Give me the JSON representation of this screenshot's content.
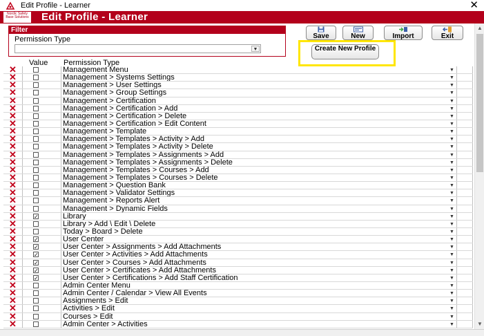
{
  "window": {
    "title": "Edit Profile - Learner",
    "close_glyph": "✕"
  },
  "header": {
    "title": "Edit Profile - Learner",
    "logo_text": "Nordic Safety Base Solutions"
  },
  "filter": {
    "heading": "Filter",
    "label": "Permission Type",
    "selected_value": ""
  },
  "toolbar": {
    "save_label": "Save",
    "new_label": "New",
    "import_label": "Import",
    "exit_label": "Exit",
    "create_new_profile_label": "Create New Profile"
  },
  "grid": {
    "columns": {
      "value": "Value",
      "permission_type": "Permission Type"
    },
    "rows": [
      {
        "checked": false,
        "text": "Management Menu"
      },
      {
        "checked": false,
        "text": "Management > Systems Settings"
      },
      {
        "checked": false,
        "text": "Management > User Settings"
      },
      {
        "checked": false,
        "text": "Management > Group Settings"
      },
      {
        "checked": false,
        "text": "Management > Certification"
      },
      {
        "checked": false,
        "text": "Management > Certification > Add"
      },
      {
        "checked": false,
        "text": "Management > Certification > Delete"
      },
      {
        "checked": false,
        "text": "Management > Certification > Edit Content"
      },
      {
        "checked": false,
        "text": "Management > Template"
      },
      {
        "checked": false,
        "text": "Management > Templates > Activity > Add"
      },
      {
        "checked": false,
        "text": "Management > Templates > Activity > Delete"
      },
      {
        "checked": false,
        "text": "Management > Templates > Assignments > Add"
      },
      {
        "checked": false,
        "text": "Management > Templates > Assignments  > Delete"
      },
      {
        "checked": false,
        "text": "Management > Templates > Courses  > Add"
      },
      {
        "checked": false,
        "text": "Management > Templates > Courses  > Delete"
      },
      {
        "checked": false,
        "text": "Management > Question Bank"
      },
      {
        "checked": false,
        "text": "Management > Validator Settings"
      },
      {
        "checked": false,
        "text": "Management > Reports Alert"
      },
      {
        "checked": false,
        "text": "Management > Dynamic Fields"
      },
      {
        "checked": true,
        "text": "Library"
      },
      {
        "checked": false,
        "text": "Library > Add \\ Edit \\ Delete"
      },
      {
        "checked": false,
        "text": "Today > Board > Delete"
      },
      {
        "checked": true,
        "text": "User Center"
      },
      {
        "checked": true,
        "text": "User Center > Assignments > Add Attachments"
      },
      {
        "checked": true,
        "text": "User Center > Activities > Add Attachments"
      },
      {
        "checked": true,
        "text": "User Center > Courses > Add Attachments"
      },
      {
        "checked": true,
        "text": "User Center > Certificates > Add Attachments"
      },
      {
        "checked": true,
        "text": "User Center > Certifications > Add Staff Certification"
      },
      {
        "checked": false,
        "text": "Admin Center Menu"
      },
      {
        "checked": false,
        "text": "Admin Center / Calendar > View All Events"
      },
      {
        "checked": false,
        "text": "Assignments > Edit"
      },
      {
        "checked": false,
        "text": "Activities > Edit"
      },
      {
        "checked": false,
        "text": "Courses > Edit"
      },
      {
        "checked": false,
        "text": "Admin Center > Activities"
      }
    ]
  },
  "colors": {
    "brand_red": "#b3001b",
    "highlight_yellow": "#ffe600",
    "delete_red": "#c0001a"
  },
  "icons": {
    "delete": "delete-x-icon",
    "save": "floppy-disk-icon",
    "new": "new-document-icon",
    "import": "import-icon",
    "exit": "exit-door-icon"
  }
}
